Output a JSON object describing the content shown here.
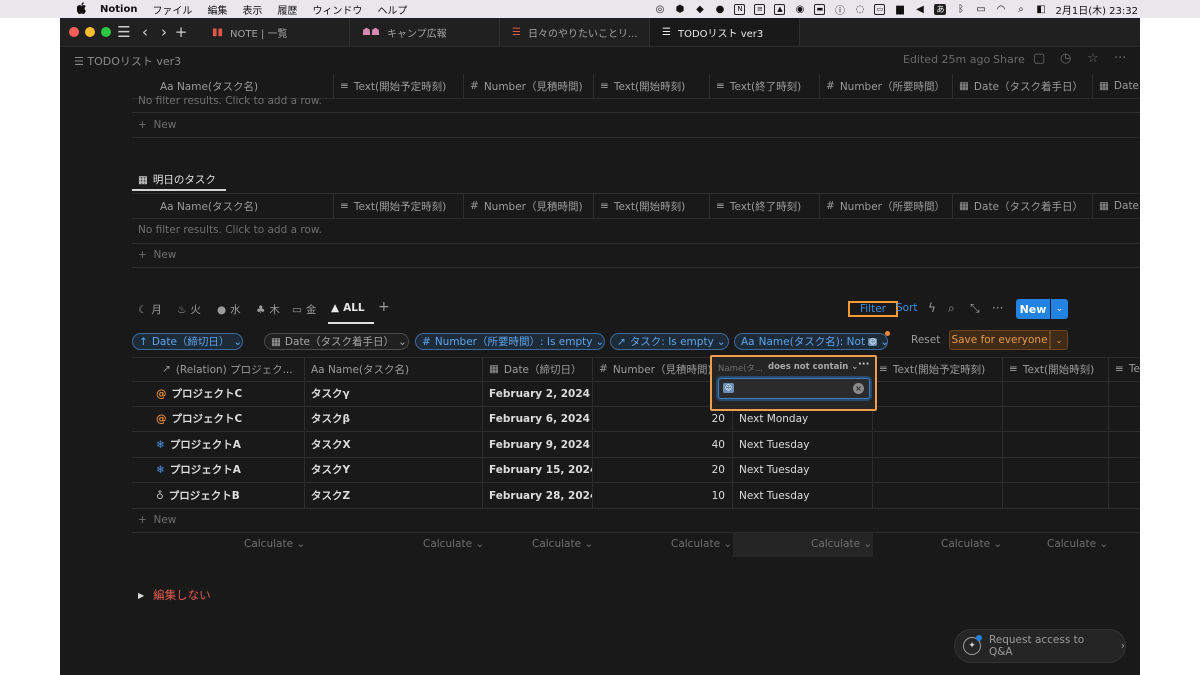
{
  "menubar": {
    "apple": "",
    "app": "Notion",
    "items": [
      "ファイル",
      "編集",
      "表示",
      "履歴",
      "ウィンドウ",
      "ヘルプ"
    ],
    "clock": "2月1日(木)  23:32",
    "kana": "あ"
  },
  "tabs": [
    {
      "label": "NOTE | 一覧",
      "icon": "book-icon",
      "active": false
    },
    {
      "label": "キャンプ広報",
      "icon": "people-icon",
      "active": false
    },
    {
      "label": "日々のやりたいことリ...",
      "icon": "checklist-icon",
      "active": false
    },
    {
      "label": "TODOリスト ver3",
      "icon": "checklist-icon",
      "active": true
    }
  ],
  "topbar": {
    "title": "TODOリスト ver3",
    "edited": "Edited 25m ago",
    "share": "Share"
  },
  "columns_header": [
    "Aa Name(タスク名)",
    "Text(開始予定時刻)",
    "Number（見積時間)",
    "Text(開始時刻)",
    "Text(終了時刻)",
    "Number（所要時間）",
    "Date（タスク着手日）",
    "Date"
  ],
  "empty_msg": "No filter results. Click to add a row.",
  "new_label": "New",
  "db2_title": "明日のタスク",
  "views": [
    {
      "icon": "moon-icon",
      "label": "月"
    },
    {
      "icon": "fire-icon",
      "label": "火"
    },
    {
      "icon": "drop-icon",
      "label": "水"
    },
    {
      "icon": "tree-icon",
      "label": "木"
    },
    {
      "icon": "coin-icon",
      "label": "金"
    },
    {
      "icon": "mountain-icon",
      "label": "ALL"
    }
  ],
  "toolbar": {
    "filter": "Filter",
    "sort": "Sort",
    "new": "New",
    "reset": "Reset",
    "save": "Save for everyone"
  },
  "chips": [
    "Date（締切日）",
    "Date（タスク着手日）",
    "Number（所要時間）: Is empty",
    "タスク: Is empty",
    "Name(タスク名): Not"
  ],
  "filter_popup": {
    "property": "Name(タ...",
    "condition": "does not contain",
    "value": ""
  },
  "main_headers": [
    "(Relation) プロジェク...",
    "Aa Name(タスク名)",
    "Date（締切日）",
    "Number（見積時間)",
    "Text(開始予定時刻)",
    "Text(開始時刻)",
    "Te"
  ],
  "rows": [
    {
      "project": "プロジェクトC",
      "picon": "at-icon",
      "task": "タスクγ",
      "date": "February 2, 2024",
      "num": "",
      "text": ""
    },
    {
      "project": "プロジェクトC",
      "picon": "at-icon",
      "task": "タスクβ",
      "date": "February 6, 2024",
      "num": "20",
      "text": "Next Monday"
    },
    {
      "project": "プロジェクトA",
      "picon": "snowflake-icon",
      "task": "タスクX",
      "date": "February 9, 2024",
      "num": "40",
      "text": "Next Tuesday"
    },
    {
      "project": "プロジェクトA",
      "picon": "snowflake-icon",
      "task": "タスクY",
      "date": "February 15, 2024",
      "num": "20",
      "text": "Next Tuesday"
    },
    {
      "project": "プロジェクトB",
      "picon": "bulb-icon",
      "task": "タスクZ",
      "date": "February 28, 2024",
      "num": "10",
      "text": "Next Tuesday"
    }
  ],
  "calculate": "Calculate ⌄",
  "toggle_label": "編集しない",
  "qa_label": "Request access to Q&A",
  "colors": {
    "bg": "#191919",
    "accent_blue": "#2383e2",
    "save_orange": "#e59b4b",
    "highlight_orange": "#f39a36",
    "toggle_red": "#e25c4d"
  }
}
